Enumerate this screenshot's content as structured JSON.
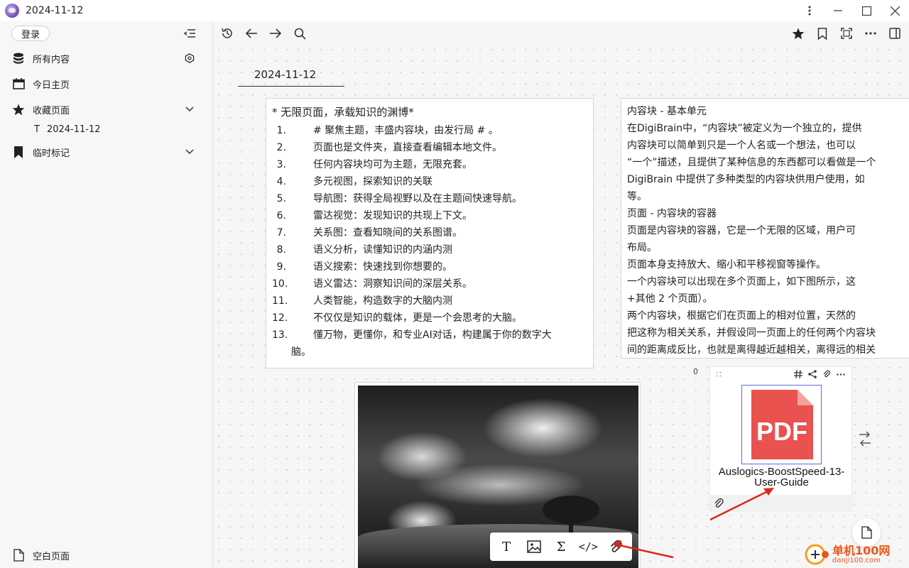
{
  "window": {
    "title": "2024-11-12"
  },
  "sidebar": {
    "login_label": "登录",
    "items": [
      {
        "label": "所有内容",
        "icon": "database-icon"
      },
      {
        "label": "今日主页",
        "icon": "calendar-icon"
      },
      {
        "label": "收藏页面",
        "icon": "star-icon"
      },
      {
        "label": "临时标记",
        "icon": "bookmark-icon"
      }
    ],
    "favorite_sub": {
      "type_glyph": "T",
      "label": "2024-11-12"
    },
    "bottom_item": {
      "label": "空白页面",
      "icon": "file-icon"
    }
  },
  "page": {
    "tab_label": "2024-11-12"
  },
  "card1": {
    "heading": "* 无限页面，承载知识的渊博*",
    "items": [
      "# 聚焦主题，丰盛内容块，由发行局 # 。",
      "页面也是文件夹，直接查看编辑本地文件。",
      "任何内容块均可为主题，无限充套。",
      "多元视图，探索知识的关联",
      "导航图：获得全局视野以及在主题间快速导航。",
      "雷达视觉：发现知识的共现上下文。",
      "关系图：查看知晓间的关系图谱。",
      "语义分析，读懂知识的内涵内测",
      "语义搜索：快速找到你想要的。",
      "语义雷达：洞察知识间的深层关系。",
      "人类智能，构造数字的大脑内测",
      "不仅仅是知识的载体，更是一个会思考的大脑。",
      "懂万物，更懂你，和专业AI对话，构建属于你的数字大",
      "脑。"
    ],
    "numbers": [
      "1.",
      "2.",
      "3.",
      "4.",
      "5.",
      "6.",
      "7.",
      "8.",
      "9.",
      "10.",
      "11.",
      "12.",
      "13."
    ]
  },
  "card2": {
    "lines": [
      "   内容块 - 基本单元",
      "        在DigiBrain中，“内容块”被定义为一个独立的，提供",
      "        内容块可以简单到只是一个人名或一个想法，也可以",
      "“一个”描述，且提供了某种信息的东西都可以看做是一个",
      "        DigiBrain 中提供了多种类型的内容块供用户使用，如",
      "等。",
      "        页面 - 内容块的容器",
      "        页面是内容块的容器，它是一个无限的区域，用户可",
      "布局。",
      "        页面本身支持放大、缩小和平移视窗等操作。",
      "        一个内容块可以出现在多个页面上，如下图所示，这",
      "+其他 2 个页面）。",
      "        两个内容块，根据它们在页面上的相对位置，天然的",
      "把这称为相关关系，并假设同一页面上的任何两个内容块",
      "间的距离成反比，也就是离得越近越相关，离得远的相关"
    ]
  },
  "pdf_block": {
    "count": "0",
    "file_name": "Auslogics-BoostSpeed-13-User-Guide",
    "thumb_text": "PDF",
    "thumb_color": "#e9524f"
  },
  "insert_toolbar": {
    "items": [
      {
        "glyph": "T",
        "icon": "text-icon"
      },
      {
        "glyph": "",
        "icon": "image-icon"
      },
      {
        "glyph": "Σ",
        "icon": "formula-icon"
      },
      {
        "glyph": "</>",
        "icon": "code-icon"
      },
      {
        "glyph": "",
        "icon": "attachment-icon"
      }
    ]
  },
  "watermark": {
    "text": "单机100网",
    "sub": "danji100.com"
  },
  "colors": {
    "annotation_arrow": "#d9261c",
    "accent": "#5b6cd6"
  }
}
